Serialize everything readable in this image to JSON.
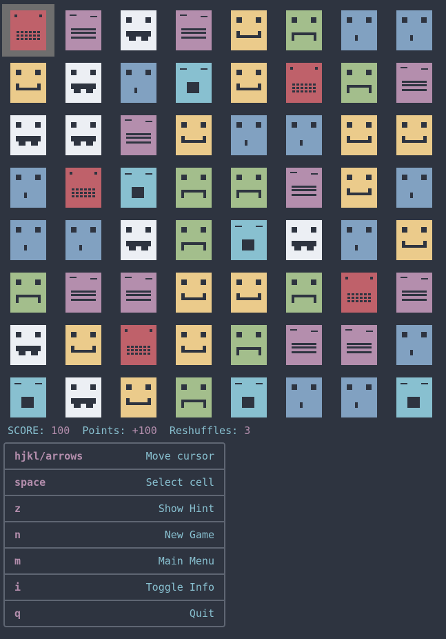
{
  "board": {
    "cursor": [
      0,
      0
    ],
    "colors": {
      "red": "#bf616a",
      "purple": "#b48ead",
      "white": "#eceff4",
      "yellow": "#ebcb8b",
      "green": "#a3be8c",
      "blue": "#81a1c1",
      "cyan": "#88c0d0",
      "ink": "#2e3440"
    },
    "rows": [
      [
        "red",
        "purple",
        "white",
        "purple",
        "yellow",
        "green",
        "blue",
        "blue"
      ],
      [
        "yellow",
        "white",
        "blue",
        "cyan",
        "yellow",
        "red",
        "green",
        "purple"
      ],
      [
        "white",
        "white",
        "purple",
        "yellow",
        "blue",
        "blue",
        "yellow",
        "yellow"
      ],
      [
        "blue",
        "red",
        "cyan",
        "green",
        "green",
        "purple",
        "yellow",
        "blue"
      ],
      [
        "blue",
        "blue",
        "white",
        "green",
        "cyan",
        "white",
        "blue",
        "yellow"
      ],
      [
        "green",
        "purple",
        "purple",
        "yellow",
        "yellow",
        "green",
        "red",
        "purple"
      ],
      [
        "white",
        "yellow",
        "red",
        "yellow",
        "green",
        "purple",
        "purple",
        "blue"
      ],
      [
        "cyan",
        "white",
        "yellow",
        "green",
        "cyan",
        "blue",
        "blue",
        "cyan"
      ]
    ]
  },
  "status": {
    "score_label": "SCORE:",
    "score": "100",
    "points_label": "Points:",
    "points": "+100",
    "reshuffles_label": "Reshuffles:",
    "reshuffles": "3"
  },
  "help": [
    {
      "key": "hjkl/arrows",
      "desc": "Move cursor"
    },
    {
      "key": "space",
      "desc": "Select cell"
    },
    {
      "key": "z",
      "desc": "Show Hint"
    },
    {
      "key": "n",
      "desc": "New Game"
    },
    {
      "key": "m",
      "desc": "Main Menu"
    },
    {
      "key": "i",
      "desc": "Toggle Info"
    },
    {
      "key": "q",
      "desc": "Quit"
    }
  ]
}
